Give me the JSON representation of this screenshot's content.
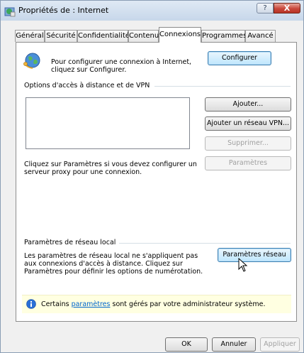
{
  "window": {
    "title": "Propriétés de : Internet",
    "help_label": "?",
    "close_label": "X"
  },
  "tabs": [
    {
      "label": "Général"
    },
    {
      "label": "Sécurité"
    },
    {
      "label": "Confidentialité"
    },
    {
      "label": "Contenu"
    },
    {
      "label": "Connexions"
    },
    {
      "label": "Programmes"
    },
    {
      "label": "Avancé"
    }
  ],
  "connection_setup": {
    "text": "Pour configurer une connexion à Internet, cliquez sur Configurer.",
    "button": "Configurer"
  },
  "dialup_vpn": {
    "heading": "Options d'accès à distance et de VPN",
    "add_button": "Ajouter...",
    "add_vpn_button": "Ajouter un réseau VPN...",
    "remove_button": "Supprimer...",
    "settings_button": "Paramètres",
    "proxy_text": "Cliquez sur Paramètres si vous devez configurer un serveur proxy pour une connexion."
  },
  "lan": {
    "heading": "Paramètres de réseau local",
    "text": "Les paramètres de réseau local ne s'appliquent pas aux connexions d'accès à distance. Cliquez sur Paramètres pour définir les options de numérotation.",
    "button": "Paramètres réseau"
  },
  "admin_notice": {
    "prefix": "Certains",
    "link": "paramètres",
    "suffix": "sont gérés par votre administrateur système."
  },
  "footer": {
    "ok": "OK",
    "cancel": "Annuler",
    "apply": "Appliquer"
  },
  "icons": {
    "app": "internet-options-icon",
    "globe": "globe-connection-icon",
    "info": "info-icon",
    "cursor": "mouse-pointer-icon"
  },
  "colors": {
    "close_button": "#c9473a",
    "link": "#0066cc",
    "info_bar": "#ffffe1",
    "info_icon": "#2a6fd6"
  }
}
